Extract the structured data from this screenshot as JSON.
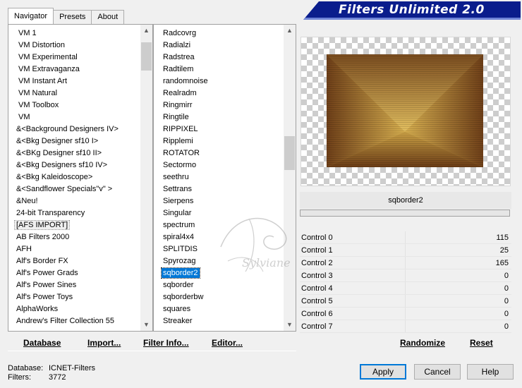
{
  "banner": {
    "title": "Filters Unlimited 2.0"
  },
  "tabs": [
    "Navigator",
    "Presets",
    "About"
  ],
  "categories": [
    "VM 1",
    "VM Distortion",
    "VM Experimental",
    "VM Extravaganza",
    "VM Instant Art",
    "VM Natural",
    "VM Toolbox",
    "VM",
    "&<Background Designers IV>",
    "&<Bkg Designer sf10 I>",
    "&<BKg Designer sf10 II>",
    "&<Bkg Designers sf10 IV>",
    "&<Bkg Kaleidoscope>",
    "&<Sandflower Specials\"v\" >",
    "&Neu!",
    "24-bit Transparency",
    "[AFS IMPORT]",
    "AB Filters 2000",
    "AFH",
    "Alf's Border FX",
    "Alf's Power Grads",
    "Alf's Power Sines",
    "Alf's Power Toys",
    "AlphaWorks",
    "Andrew's Filter Collection 55"
  ],
  "filters": [
    "Radcovrg",
    "Radialzi",
    "Radstrea",
    "Radtilem",
    "randomnoise",
    "Realradm",
    "Ringmirr",
    "Ringtile",
    "RIPPIXEL",
    "Ripplemi",
    "ROTATOR",
    "Sectormo",
    "seethru",
    "Settrans",
    "Sierpens",
    "Singular",
    "spectrum",
    "spiral4x4",
    "SPLITDIS",
    "Spyrozag",
    "sqborder2",
    "sqborder",
    "sqborderbw",
    "squares",
    "Streaker"
  ],
  "selected_filter": "sqborder2",
  "controls": [
    {
      "label": "Control 0",
      "value": "115"
    },
    {
      "label": "Control 1",
      "value": "25"
    },
    {
      "label": "Control 2",
      "value": "165"
    },
    {
      "label": "Control 3",
      "value": "0"
    },
    {
      "label": "Control 4",
      "value": "0"
    },
    {
      "label": "Control 5",
      "value": "0"
    },
    {
      "label": "Control 6",
      "value": "0"
    },
    {
      "label": "Control 7",
      "value": "0"
    }
  ],
  "buttons": {
    "database": "Database",
    "import": "Import...",
    "filter_info": "Filter Info...",
    "editor": "Editor...",
    "randomize": "Randomize",
    "reset": "Reset",
    "apply": "Apply",
    "cancel": "Cancel",
    "help": "Help"
  },
  "status": {
    "database_label": "Database:",
    "database_value": "ICNET-Filters",
    "filters_label": "Filters:",
    "filters_value": "3772"
  },
  "watermark": "Sylviane",
  "colors": {
    "accent": "#0078d7",
    "banner": "#0a1d8c",
    "preview_gold": "#c9a23e",
    "preview_brown": "#7a4a1e"
  }
}
